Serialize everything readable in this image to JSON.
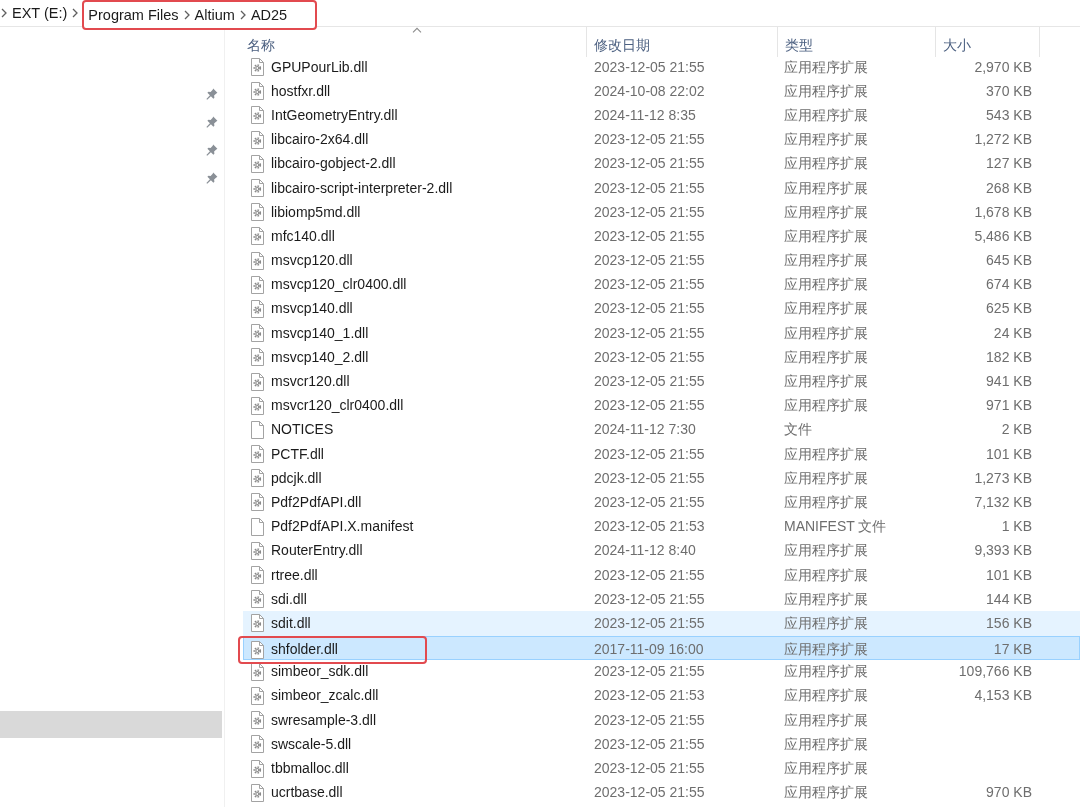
{
  "address_bar": {
    "breadcrumbs": [
      {
        "label": "EXT (E:)",
        "highlighted": false
      },
      {
        "label": "Program Files",
        "highlighted": true
      },
      {
        "label": "Altium",
        "highlighted": true
      },
      {
        "label": "AD25",
        "highlighted": true
      }
    ]
  },
  "navigation_pane": {
    "quick_access_items": [
      {
        "pinned": true
      },
      {
        "pinned": true
      },
      {
        "pinned": true
      },
      {
        "pinned": true
      }
    ],
    "selected_item": {
      "selected": true
    }
  },
  "file_list": {
    "columns": [
      {
        "label": "名称",
        "sorted": true
      },
      {
        "label": "修改日期",
        "sorted": false
      },
      {
        "label": "类型",
        "sorted": false
      },
      {
        "label": "大小",
        "sorted": false
      }
    ],
    "rows": [
      {
        "kind": "extension",
        "name": "GPUPourLib.dll",
        "modified": "2023-12-05 21:55",
        "type": "应用程序扩展",
        "size": "2,970 KB",
        "selected": false,
        "hovered": false,
        "highlighted": false
      },
      {
        "kind": "extension",
        "name": "hostfxr.dll",
        "modified": "2024-10-08 22:02",
        "type": "应用程序扩展",
        "size": "370 KB",
        "selected": false,
        "hovered": false,
        "highlighted": false
      },
      {
        "kind": "extension",
        "name": "IntGeometryEntry.dll",
        "modified": "2024-11-12 8:35",
        "type": "应用程序扩展",
        "size": "543 KB",
        "selected": false,
        "hovered": false,
        "highlighted": false
      },
      {
        "kind": "extension",
        "name": "libcairo-2x64.dll",
        "modified": "2023-12-05 21:55",
        "type": "应用程序扩展",
        "size": "1,272 KB",
        "selected": false,
        "hovered": false,
        "highlighted": false
      },
      {
        "kind": "extension",
        "name": "libcairo-gobject-2.dll",
        "modified": "2023-12-05 21:55",
        "type": "应用程序扩展",
        "size": "127 KB",
        "selected": false,
        "hovered": false,
        "highlighted": false
      },
      {
        "kind": "extension",
        "name": "libcairo-script-interpreter-2.dll",
        "modified": "2023-12-05 21:55",
        "type": "应用程序扩展",
        "size": "268 KB",
        "selected": false,
        "hovered": false,
        "highlighted": false
      },
      {
        "kind": "extension",
        "name": "libiomp5md.dll",
        "modified": "2023-12-05 21:55",
        "type": "应用程序扩展",
        "size": "1,678 KB",
        "selected": false,
        "hovered": false,
        "highlighted": false
      },
      {
        "kind": "extension",
        "name": "mfc140.dll",
        "modified": "2023-12-05 21:55",
        "type": "应用程序扩展",
        "size": "5,486 KB",
        "selected": false,
        "hovered": false,
        "highlighted": false
      },
      {
        "kind": "extension",
        "name": "msvcp120.dll",
        "modified": "2023-12-05 21:55",
        "type": "应用程序扩展",
        "size": "645 KB",
        "selected": false,
        "hovered": false,
        "highlighted": false
      },
      {
        "kind": "extension",
        "name": "msvcp120_clr0400.dll",
        "modified": "2023-12-05 21:55",
        "type": "应用程序扩展",
        "size": "674 KB",
        "selected": false,
        "hovered": false,
        "highlighted": false
      },
      {
        "kind": "extension",
        "name": "msvcp140.dll",
        "modified": "2023-12-05 21:55",
        "type": "应用程序扩展",
        "size": "625 KB",
        "selected": false,
        "hovered": false,
        "highlighted": false
      },
      {
        "kind": "extension",
        "name": "msvcp140_1.dll",
        "modified": "2023-12-05 21:55",
        "type": "应用程序扩展",
        "size": "24 KB",
        "selected": false,
        "hovered": false,
        "highlighted": false
      },
      {
        "kind": "extension",
        "name": "msvcp140_2.dll",
        "modified": "2023-12-05 21:55",
        "type": "应用程序扩展",
        "size": "182 KB",
        "selected": false,
        "hovered": false,
        "highlighted": false
      },
      {
        "kind": "extension",
        "name": "msvcr120.dll",
        "modified": "2023-12-05 21:55",
        "type": "应用程序扩展",
        "size": "941 KB",
        "selected": false,
        "hovered": false,
        "highlighted": false
      },
      {
        "kind": "extension",
        "name": "msvcr120_clr0400.dll",
        "modified": "2023-12-05 21:55",
        "type": "应用程序扩展",
        "size": "971 KB",
        "selected": false,
        "hovered": false,
        "highlighted": false
      },
      {
        "kind": "file",
        "name": "NOTICES",
        "modified": "2024-11-12 7:30",
        "type": "文件",
        "size": "2 KB",
        "selected": false,
        "hovered": false,
        "highlighted": false
      },
      {
        "kind": "extension",
        "name": "PCTF.dll",
        "modified": "2023-12-05 21:55",
        "type": "应用程序扩展",
        "size": "101 KB",
        "selected": false,
        "hovered": false,
        "highlighted": false
      },
      {
        "kind": "extension",
        "name": "pdcjk.dll",
        "modified": "2023-12-05 21:55",
        "type": "应用程序扩展",
        "size": "1,273 KB",
        "selected": false,
        "hovered": false,
        "highlighted": false
      },
      {
        "kind": "extension",
        "name": "Pdf2PdfAPI.dll",
        "modified": "2023-12-05 21:55",
        "type": "应用程序扩展",
        "size": "7,132 KB",
        "selected": false,
        "hovered": false,
        "highlighted": false
      },
      {
        "kind": "file",
        "name": "Pdf2PdfAPI.X.manifest",
        "modified": "2023-12-05 21:53",
        "type": "MANIFEST 文件",
        "size": "1 KB",
        "selected": false,
        "hovered": false,
        "highlighted": false
      },
      {
        "kind": "extension",
        "name": "RouterEntry.dll",
        "modified": "2024-11-12 8:40",
        "type": "应用程序扩展",
        "size": "9,393 KB",
        "selected": false,
        "hovered": false,
        "highlighted": false
      },
      {
        "kind": "extension",
        "name": "rtree.dll",
        "modified": "2023-12-05 21:55",
        "type": "应用程序扩展",
        "size": "101 KB",
        "selected": false,
        "hovered": false,
        "highlighted": false
      },
      {
        "kind": "extension",
        "name": "sdi.dll",
        "modified": "2023-12-05 21:55",
        "type": "应用程序扩展",
        "size": "144 KB",
        "selected": false,
        "hovered": false,
        "highlighted": false
      },
      {
        "kind": "extension",
        "name": "sdit.dll",
        "modified": "2023-12-05 21:55",
        "type": "应用程序扩展",
        "size": "156 KB",
        "selected": false,
        "hovered": true,
        "highlighted": false
      },
      {
        "kind": "extension",
        "name": "shfolder.dll",
        "modified": "2017-11-09 16:00",
        "type": "应用程序扩展",
        "size": "17 KB",
        "selected": true,
        "hovered": false,
        "highlighted": true
      },
      {
        "kind": "extension",
        "name": "simbeor_sdk.dll",
        "modified": "2023-12-05 21:55",
        "type": "应用程序扩展",
        "size": "109,766 KB",
        "selected": false,
        "hovered": false,
        "highlighted": false
      },
      {
        "kind": "extension",
        "name": "simbeor_zcalc.dll",
        "modified": "2023-12-05 21:53",
        "type": "应用程序扩展",
        "size": "4,153 KB",
        "selected": false,
        "hovered": false,
        "highlighted": false
      },
      {
        "kind": "extension",
        "name": "swresample-3.dll",
        "modified": "2023-12-05 21:55",
        "type": "应用程序扩展",
        "selected": false,
        "hovered": false,
        "highlighted": false
      },
      {
        "kind": "extension",
        "name": "swscale-5.dll",
        "modified": "2023-12-05 21:55",
        "type": "应用程序扩展",
        "selected": false,
        "hovered": false,
        "highlighted": false
      },
      {
        "kind": "extension",
        "name": "tbbmalloc.dll",
        "modified": "2023-12-05 21:55",
        "type": "应用程序扩展",
        "selected": false,
        "hovered": false,
        "highlighted": false
      },
      {
        "kind": "extension",
        "name": "ucrtbase.dll",
        "modified": "2023-12-05 21:55",
        "type": "应用程序扩展",
        "size": "970 KB",
        "selected": false,
        "hovered": false,
        "highlighted": false
      }
    ]
  }
}
